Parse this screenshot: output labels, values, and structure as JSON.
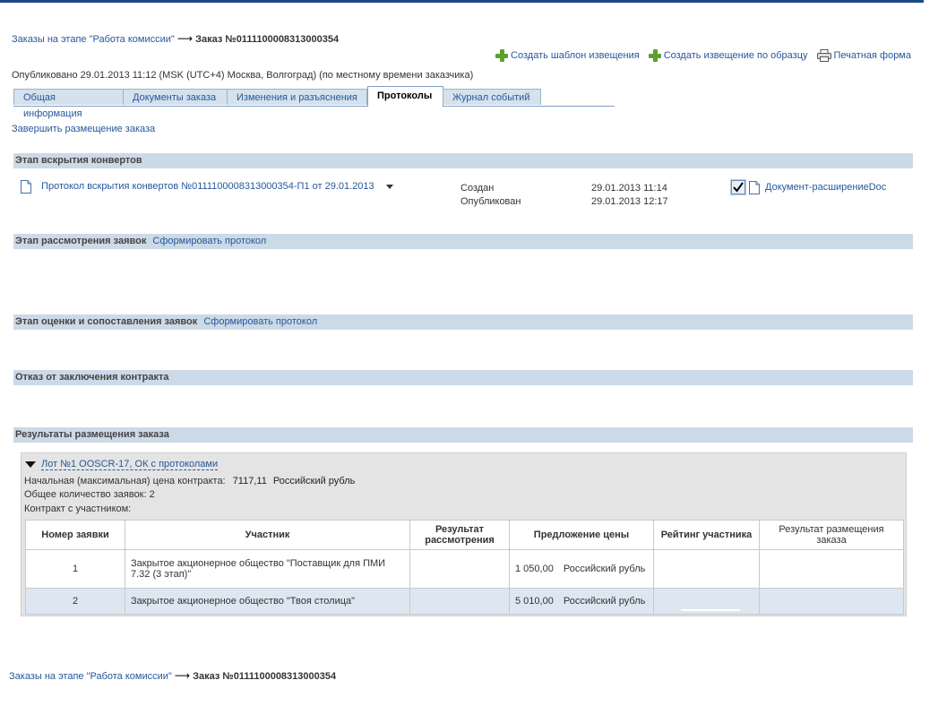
{
  "breadcrumb": {
    "link": "Заказы на этапе \"Работа комиссии\"",
    "arrow": "⟶",
    "current": "Заказ №0111100008313000354"
  },
  "toolbar": {
    "create_template": "Создать шаблон извещения",
    "create_by_sample": "Создать извещение по образцу",
    "print_form": "Печатная форма"
  },
  "published": "Опубликовано 29.01.2013 11:12 (MSK (UTC+4) Москва, Волгоград) (по местному времени заказчика)",
  "tabs": [
    {
      "label": "Общая информация"
    },
    {
      "label": "Документы заказа"
    },
    {
      "label": "Изменения и разъяснения"
    },
    {
      "label": "Протоколы"
    },
    {
      "label": "Журнал событий"
    }
  ],
  "complete_link": "Завершить размещение заказа",
  "sections": {
    "opening": "Этап вскрытия конвертов",
    "review": "Этап рассмотрения заявок",
    "review_action": "Сформировать протокол",
    "evaluation": "Этап оценки и сопоставления заявок",
    "evaluation_action": "Сформировать протокол",
    "refusal": "Отказ от заключения контракта",
    "results": "Результаты размещения заказа"
  },
  "protocol": {
    "title": "Протокол вскрытия конвертов №0111100008313000354-П1 от 29.01.2013",
    "status1": "Создан",
    "date1": "29.01.2013 11:14",
    "status2": "Опубликован",
    "date2": "29.01.2013 12:17",
    "attachment": "Документ-расширениеDoc"
  },
  "lot": {
    "title": "Лот №1 OOSCR-17, ОК с протоколами",
    "price_label": "Начальная (максимальная) цена контракта:",
    "price_value": "7117,11",
    "currency": "Российский рубль",
    "total_label": "Общее количество заявок: 2",
    "contract_label": "Контракт с участником:"
  },
  "table": {
    "headers": [
      "Номер заявки",
      "Участник",
      "Результат рассмотрения",
      "Предложение цены",
      "Рейтинг участника",
      "Результат размещения заказа"
    ],
    "rows": [
      {
        "num": "1",
        "participant": "Закрытое акционерное общество \"Поставщик для ПМИ 7.32 (3 этап)\"",
        "result": "",
        "price": "1 050,00",
        "currency": "Российский рубль",
        "rating": "",
        "outcome": ""
      },
      {
        "num": "2",
        "participant": "Закрытое акционерное общество \"Твоя столица\"",
        "result": "",
        "price": "5 010,00",
        "currency": "Российский рубль",
        "rating": "",
        "outcome": ""
      }
    ]
  },
  "footer_breadcrumb": {
    "link": "Заказы на этапе \"Работа комиссии\"",
    "arrow": "⟶",
    "current": "Заказ №0111100008313000354"
  }
}
